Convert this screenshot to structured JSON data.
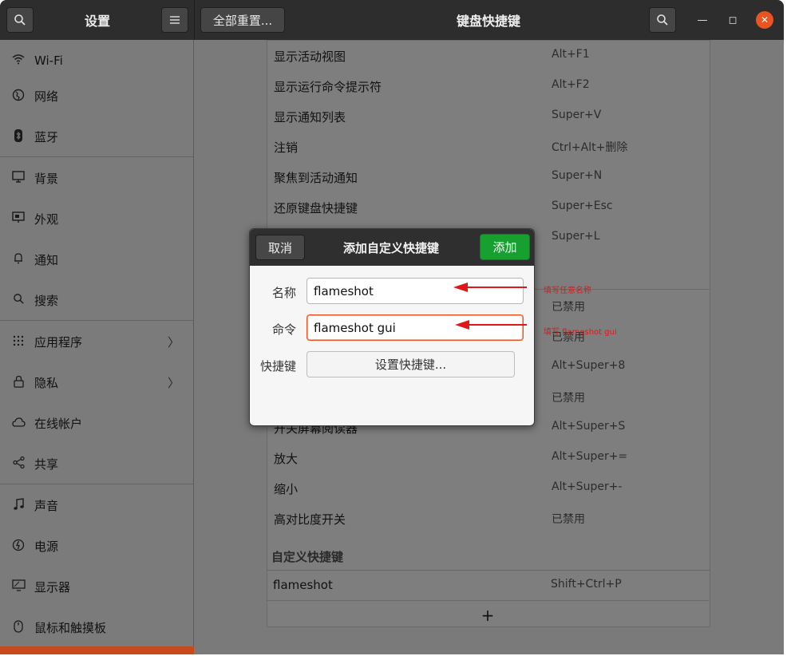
{
  "header": {
    "left_title": "设置",
    "reset_label": "全部重置...",
    "right_title": "键盘快捷键",
    "close_glyph": "✕",
    "min_glyph": "—",
    "max_glyph": "◻"
  },
  "sidebar": {
    "items": [
      {
        "label": "Wi-Fi",
        "icon": "wifi-icon"
      },
      {
        "label": "网络",
        "icon": "network-icon"
      },
      {
        "label": "蓝牙",
        "icon": "bluetooth-icon"
      },
      {
        "label": "背景",
        "icon": "background-icon"
      },
      {
        "label": "外观",
        "icon": "appearance-icon"
      },
      {
        "label": "通知",
        "icon": "notification-bell-icon"
      },
      {
        "label": "搜索",
        "icon": "search-icon"
      },
      {
        "label": "应用程序",
        "icon": "apps-grid-icon"
      },
      {
        "label": "隐私",
        "icon": "lock-icon"
      },
      {
        "label": "在线帐户",
        "icon": "cloud-icon"
      },
      {
        "label": "共享",
        "icon": "share-icon"
      },
      {
        "label": "声音",
        "icon": "music-note-icon"
      },
      {
        "label": "电源",
        "icon": "power-icon"
      },
      {
        "label": "显示器",
        "icon": "display-icon"
      },
      {
        "label": "鼠标和触摸板",
        "icon": "mouse-icon"
      }
    ],
    "chevron": "〉"
  },
  "shortcuts": {
    "rows": [
      {
        "name": "显示活动视图",
        "key": "Alt+F1"
      },
      {
        "name": "显示运行命令提示符",
        "key": "Alt+F2"
      },
      {
        "name": "显示通知列表",
        "key": "Super+V"
      },
      {
        "name": "注销",
        "key": "Ctrl+Alt+删除"
      },
      {
        "name": "聚焦到活动通知",
        "key": "Super+N"
      },
      {
        "name": "还原键盘快捷键",
        "key": "Super+Esc"
      },
      {
        "name": "",
        "key": "Super+L"
      },
      {
        "name": "",
        "key": "已禁用"
      },
      {
        "name": "",
        "key": "已禁用"
      },
      {
        "name": "",
        "key": "Alt+Super+8"
      },
      {
        "name": "",
        "key": "已禁用"
      },
      {
        "name": "开关屏幕阅读器",
        "key": "Alt+Super+S"
      },
      {
        "name": "放大",
        "key": "Alt+Super+="
      },
      {
        "name": "缩小",
        "key": "Alt+Super+-"
      },
      {
        "name": "高对比度开关",
        "key": "已禁用"
      }
    ],
    "custom_header": "自定义快捷键",
    "custom_rows": [
      {
        "name": "flameshot",
        "key": "Shift+Ctrl+P"
      }
    ],
    "add_glyph": "+"
  },
  "dialog": {
    "cancel_label": "取消",
    "title": "添加自定义快捷键",
    "add_label": "添加",
    "name_label": "名称",
    "name_value": "flameshot",
    "command_label": "命令",
    "command_value": "flameshot gui",
    "shortcut_label": "快捷键",
    "shortcut_button": "设置快捷键..."
  },
  "annotations": {
    "name_note": "填写任意名称",
    "command_note": "填写 flameshot gui",
    "color": "#e01818"
  },
  "colors": {
    "accent": "#e95420",
    "confirm": "#17a030"
  }
}
